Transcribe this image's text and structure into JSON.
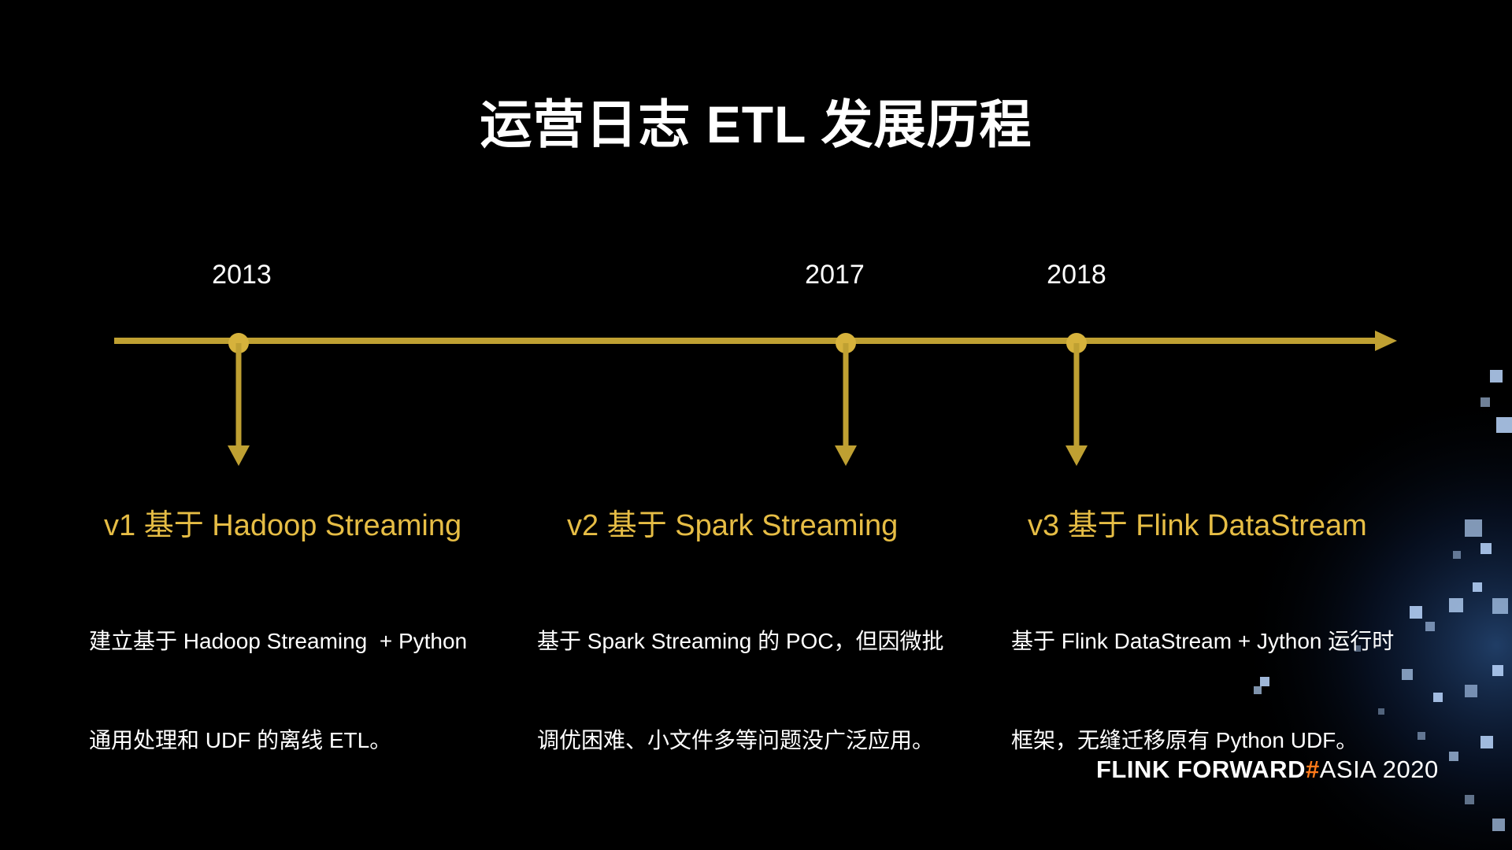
{
  "title": "运营日志 ETL 发展历程",
  "colors": {
    "background": "#000000",
    "timeline": "#bfa032",
    "accent_text": "#e6bd45",
    "brand_hash": "#ff7a1a"
  },
  "timeline": {
    "milestones": [
      {
        "year": "2013",
        "version": "v1 基于 Hadoop Streaming",
        "desc_line1": "建立基于 Hadoop Streaming  + Python",
        "desc_line2": "通用处理和 UDF 的离线 ETL。"
      },
      {
        "year": "2017",
        "version": "v2 基于 Spark Streaming",
        "desc_line1": "基于 Spark Streaming 的 POC，但因微批",
        "desc_line2": "调优困难、小文件多等问题没广泛应用。"
      },
      {
        "year": "2018",
        "version": "v3 基于 Flink DataStream",
        "desc_line1": "基于 Flink DataStream + Jython 运行时",
        "desc_line2": "框架，无缝迁移原有 Python UDF。"
      }
    ]
  },
  "brand": {
    "part1": "FLINK  FORWARD",
    "hash": "#",
    "part2": "ASIA 2020"
  },
  "decoration": {
    "icon": "glowing-cubes-decoration"
  }
}
